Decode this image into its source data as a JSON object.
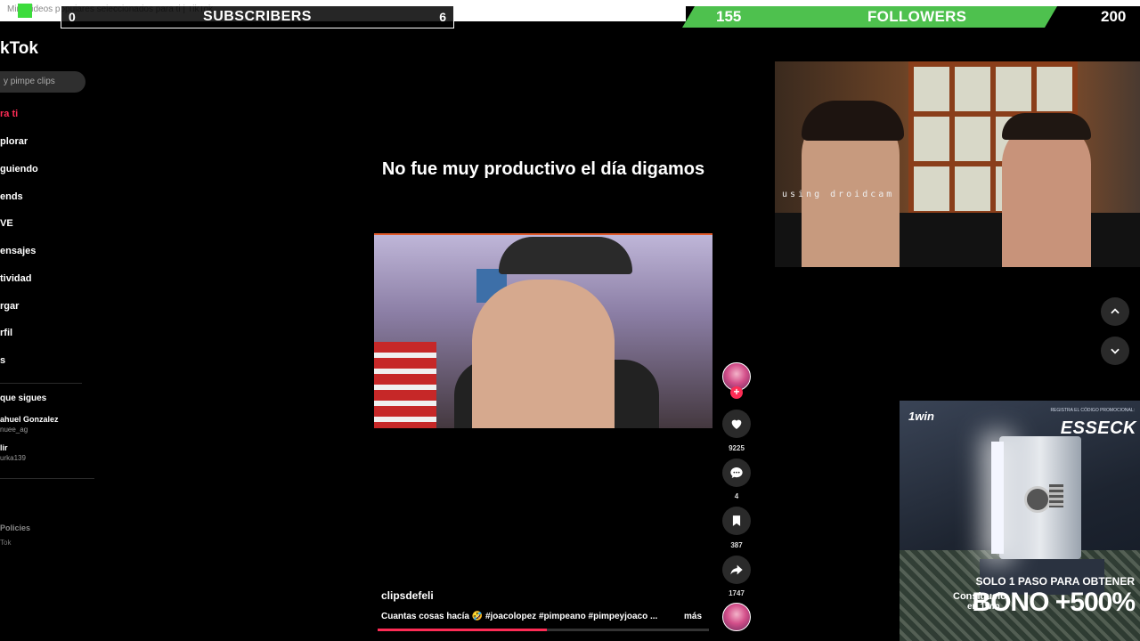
{
  "browser": {
    "tab_title": "Mira videos populares seleccionados para ti | TikTok"
  },
  "subscribers": {
    "start": "0",
    "label": "SUBSCRIBERS",
    "goal": "6"
  },
  "followers": {
    "current": "155",
    "label": "FOLLOWERS",
    "goal": "200",
    "progress": 0.78
  },
  "sidebar": {
    "logo": "kTok",
    "search_placeholder": "y pimpe clips",
    "items": [
      {
        "label": "ra ti",
        "active": true
      },
      {
        "label": "plorar"
      },
      {
        "label": "guiendo"
      },
      {
        "label": "ends"
      },
      {
        "label": "VE"
      },
      {
        "label": "ensajes"
      },
      {
        "label": "tividad"
      },
      {
        "label": "rgar"
      },
      {
        "label": "rfil"
      },
      {
        "label": "s"
      }
    ],
    "following_heading": "que sigues",
    "accounts": [
      {
        "name": "ahuel Gonzalez",
        "handle": "nuee_ag"
      },
      {
        "name": "lir",
        "handle": "urka139"
      }
    ],
    "footer_policies": "Policies",
    "footer_brand": "Tok"
  },
  "video": {
    "caption": "No fue muy productivo el día digamos",
    "username": "clipsdefeli",
    "description": "Cuantas cosas hacía 🤣 #joacolopez #pimpeano #pimpeyjoaco ...",
    "more": "más",
    "progress": 0.51
  },
  "actions": {
    "likes": "9225",
    "comments": "4",
    "saves": "387",
    "shares": "1747"
  },
  "webcam": {
    "overlay": "using droidcam"
  },
  "ad": {
    "logo": "1win",
    "top_text": "REGISTRA EL CÓDIGO PROMOCIONAL:",
    "code": "ESSECK",
    "cta_line1": "Consíguelo",
    "cta_line2": "en 1win",
    "steps": "SOLO 1 PASO PARA OBTENER",
    "bonus": "BONO +500%"
  },
  "colors": {
    "accent": "#fe2c55",
    "follow_bar": "#4ec14e"
  }
}
